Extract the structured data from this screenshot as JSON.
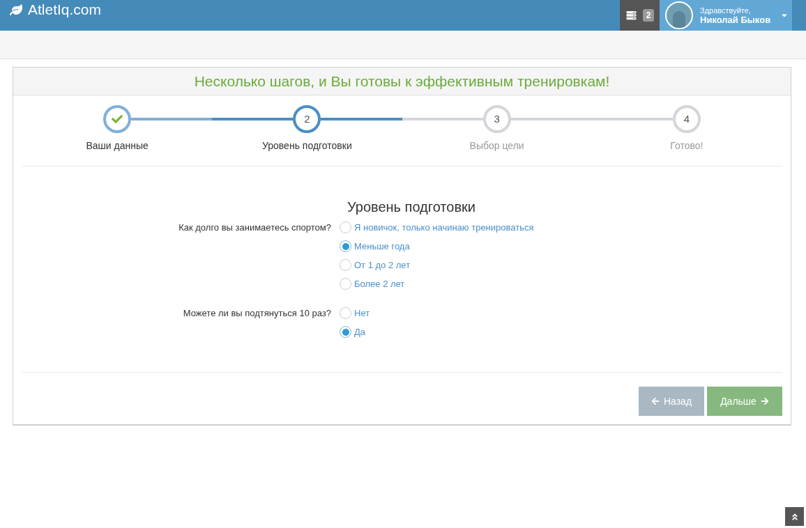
{
  "navbar": {
    "logo": "AtletIq.com",
    "notifications_count": "2",
    "greeting": "Здравствуйте,",
    "user_name": "Николай Быков"
  },
  "wizard": {
    "title": "Несколько шагов, и Вы готовы к эффективным тренировкам!",
    "steps": [
      {
        "label": "Ваши данные",
        "completed": true,
        "selected": false
      },
      {
        "number": "2",
        "label": "Уровень подготовки",
        "completed": false,
        "selected": true
      },
      {
        "number": "3",
        "label": "Выбор цели",
        "completed": false,
        "selected": false
      },
      {
        "number": "4",
        "label": "Готово!",
        "completed": false,
        "selected": false
      }
    ],
    "section_title": "Уровень подготовки",
    "questions": [
      {
        "label": "Как долго вы занимаетесь спортом?",
        "options": [
          {
            "label": "Я новичок, только начинаю тренироваться",
            "selected": false
          },
          {
            "label": "Меньше года",
            "selected": true
          },
          {
            "label": "От 1 до 2 лет",
            "selected": false
          },
          {
            "label": "Более 2 лет",
            "selected": false
          }
        ]
      },
      {
        "label": "Можете ли вы подтянуться 10 раз?",
        "options": [
          {
            "label": "Нет",
            "selected": false
          },
          {
            "label": "Да",
            "selected": true
          }
        ]
      }
    ],
    "back_button": "Назад",
    "next_button": "Дальше"
  }
}
